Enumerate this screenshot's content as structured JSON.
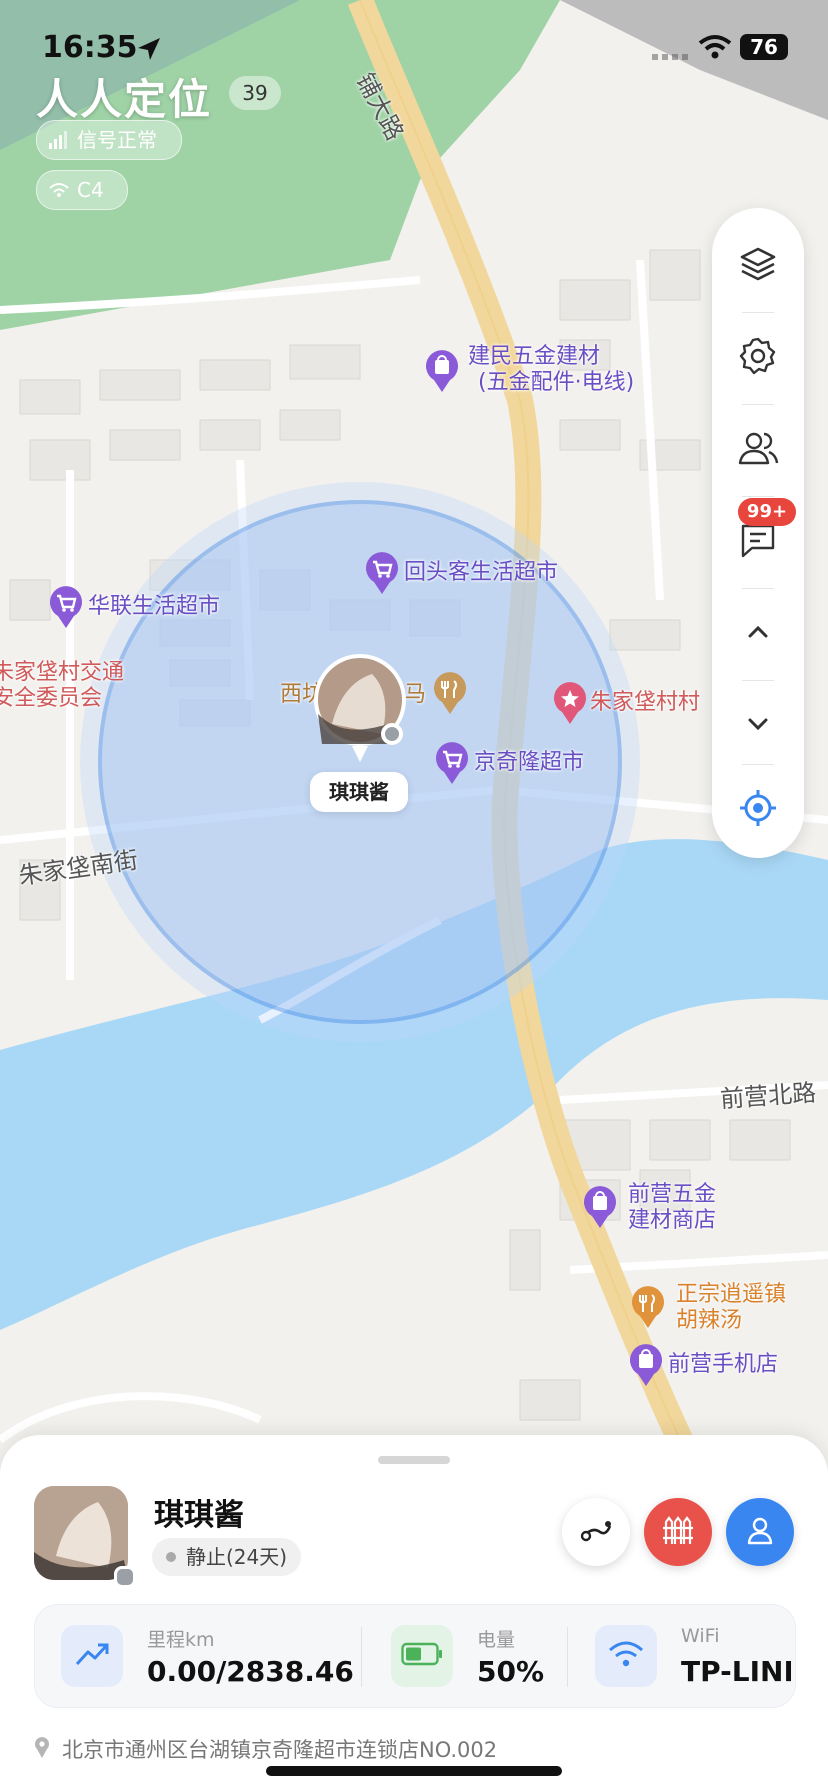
{
  "status_bar": {
    "time": "16:35",
    "battery": "76"
  },
  "header": {
    "title": "人人定位",
    "count_badge": "39",
    "signal_label": "信号正常",
    "wifi_label": "C4"
  },
  "map": {
    "pois": [
      {
        "label_line1": "建民五金建材",
        "label_line2": "(五金配件·电线)",
        "icon": "shopping-bag-pin"
      },
      {
        "label_line1": "回头客生活超市",
        "icon": "shopping-cart-pin"
      },
      {
        "label_line1": "华联生活超市",
        "icon": "shopping-cart-pin"
      },
      {
        "label_line1": "朱家垡村交通",
        "label_line2": "安全委员会"
      },
      {
        "label_line1": "西坊",
        "label_line2": "马",
        "icon": "restaurant-pin"
      },
      {
        "label_line1": "朱家垡村村",
        "icon": "star-pin"
      },
      {
        "label_line1": "京奇隆超市",
        "icon": "shopping-cart-pin"
      },
      {
        "label_line1": "前营五金",
        "label_line2": "建材商店",
        "icon": "shopping-bag-pin"
      },
      {
        "label_line1": "正宗逍遥镇",
        "label_line2": "胡辣汤",
        "icon": "restaurant-pin"
      },
      {
        "label_line1": "前营手机店",
        "icon": "shopping-bag-pin"
      }
    ],
    "roads": [
      "铺大路",
      "朱家垡南街",
      "前营北路"
    ],
    "marker_name": "琪琪酱"
  },
  "side_toolbar": {
    "items": [
      "layers-icon",
      "gear-icon",
      "users-icon",
      "message-icon",
      "chevron-up-icon",
      "chevron-down-icon",
      "locate-icon"
    ],
    "message_badge": "99+"
  },
  "panel": {
    "name": "琪琪酱",
    "state": "静止(24天)",
    "actions": [
      {
        "name": "route-button",
        "color": "#ffffff"
      },
      {
        "name": "fence-button",
        "color": "#e8524a"
      },
      {
        "name": "profile-button",
        "color": "#3a86f0"
      }
    ],
    "stats": [
      {
        "label": "里程km",
        "value": "0.00/2838.46",
        "icon": "trend-icon"
      },
      {
        "label": "电量",
        "value": "50%",
        "icon": "battery-icon"
      },
      {
        "label": "WiFi",
        "value": "TP-LINK_",
        "icon": "wifi-icon"
      }
    ],
    "address": "北京市通州区台湖镇京奇隆超市连锁店NO.002"
  },
  "colors": {
    "accent": "#3a86f0",
    "poi_purple": "#8a5ad8",
    "poi_orange": "#e0933a",
    "water": "#a9d8f6",
    "park": "#9fd3a6"
  }
}
